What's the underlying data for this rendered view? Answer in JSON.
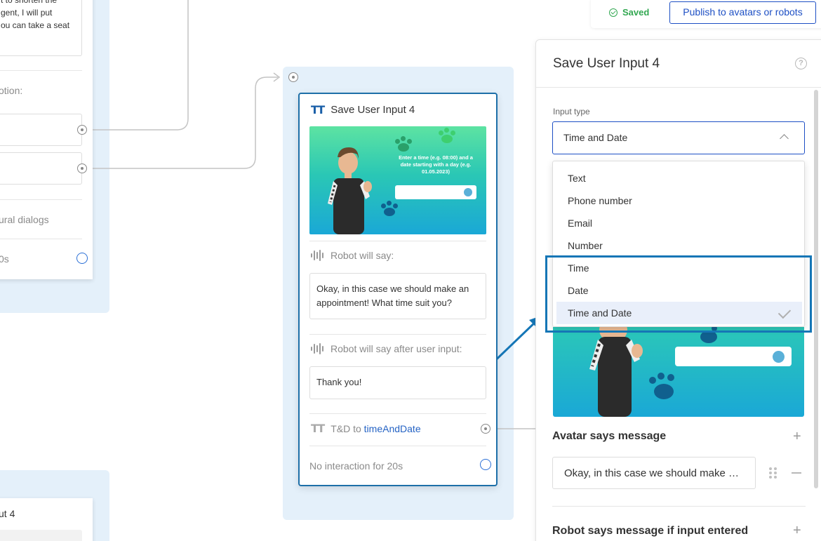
{
  "left_node": {
    "message_lines": [
      "t to shorten the",
      "gent, I will put",
      "ou can take a seat"
    ],
    "option_label": "otion:",
    "natural_dialogs": "ural dialogs",
    "timeout": "0s",
    "bottom_title": "ut 4"
  },
  "center_node": {
    "title": "Save User Input 4",
    "image_text": "Enter a time (e.g. 08:00) and a date starting with a day (e.g. 01.05.2023)",
    "robot_will_say_label": "Robot will say:",
    "robot_will_say_text": "Okay, in this case we should make an appointment! What time suit you?",
    "robot_after_label": "Robot will say after user input:",
    "robot_after_text": "Thank you!",
    "td_prefix": "T&D to ",
    "td_variable": "timeAndDate",
    "no_interaction": "No interaction for 20s"
  },
  "toolbar": {
    "saved_label": "Saved",
    "publish_label": "Publish to avatars or robots"
  },
  "panel": {
    "title": "Save User Input 4",
    "input_type_label": "Input type",
    "input_type_value": "Time and Date",
    "options": [
      "Text",
      "Phone number",
      "Email",
      "Number",
      "Time",
      "Date",
      "Time and Date"
    ],
    "selected_option": "Time and Date",
    "avatar_says_title": "Avatar says message",
    "avatar_says_text": "Okay, in this case we should make an appointment! What time suit you?",
    "robot_says_title": "Robot says message if input entered"
  },
  "colors": {
    "accent": "#1d4fc4",
    "node_border": "#1d6fa8",
    "canvas_bg": "#e4f0fa",
    "saved_green": "#33a852",
    "highlight": "#1576b6"
  }
}
